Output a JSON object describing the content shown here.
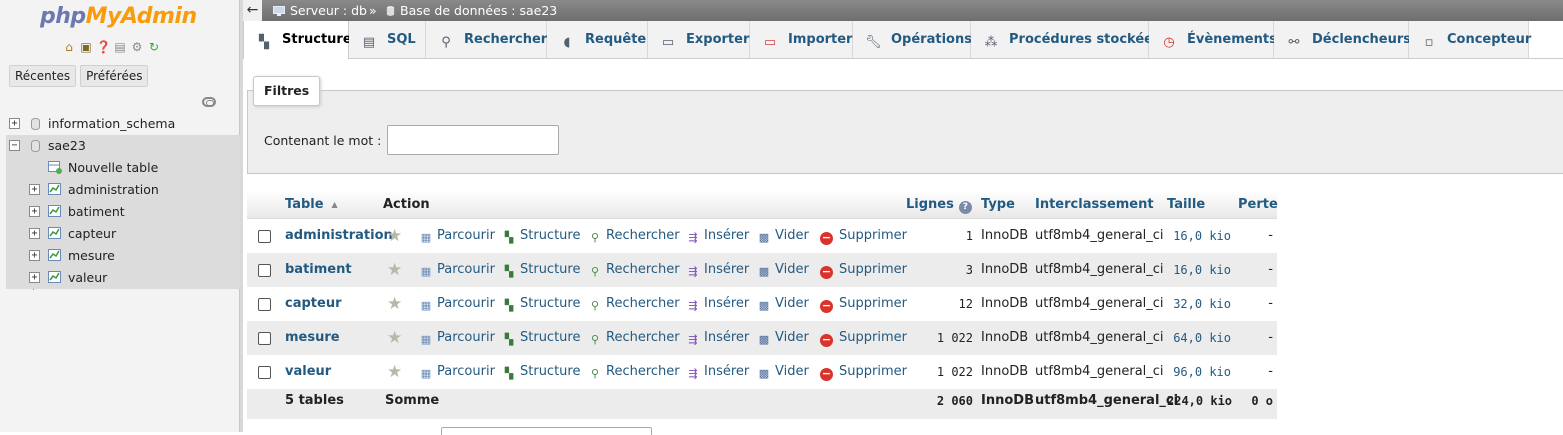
{
  "nav": {
    "logo_php": "php",
    "logo_myadmin": "MyAdmin",
    "icons": [
      "home-icon",
      "exit-icon",
      "help-icon",
      "docs-icon",
      "settings-icon",
      "reload-icon"
    ],
    "recent_label": "Récentes",
    "favorites_label": "Préférées",
    "tree": [
      {
        "label": "information_schema",
        "type": "database",
        "expander": "+"
      },
      {
        "label": "sae23",
        "type": "database",
        "expander": "−",
        "selected": true
      },
      {
        "label": "Nouvelle table",
        "type": "new-table"
      },
      {
        "label": "administration",
        "type": "table",
        "expander": "+"
      },
      {
        "label": "batiment",
        "type": "table",
        "expander": "+"
      },
      {
        "label": "capteur",
        "type": "table",
        "expander": "+"
      },
      {
        "label": "mesure",
        "type": "table",
        "expander": "+"
      },
      {
        "label": "valeur",
        "type": "table",
        "expander": "+"
      }
    ]
  },
  "breadcrumb": {
    "server": "Serveur : db",
    "separator": "»",
    "database": "Base de données : sae23"
  },
  "tabs": [
    {
      "label": "Structure",
      "icon": "structure-icon",
      "active": true
    },
    {
      "label": "SQL",
      "icon": "sql-icon"
    },
    {
      "label": "Rechercher",
      "icon": "search-icon"
    },
    {
      "label": "Requête",
      "icon": "query-icon"
    },
    {
      "label": "Exporter",
      "icon": "export-icon"
    },
    {
      "label": "Importer",
      "icon": "import-icon"
    },
    {
      "label": "Opérations",
      "icon": "wrench-icon"
    },
    {
      "label": "Procédures stockées",
      "icon": "routines-icon"
    },
    {
      "label": "Évènements",
      "icon": "clock-icon"
    },
    {
      "label": "Déclencheurs",
      "icon": "triggers-icon"
    },
    {
      "label": "Concepteur",
      "icon": "designer-icon"
    }
  ],
  "filters": {
    "legend": "Filtres",
    "contains_label": "Contenant le mot :",
    "contains_value": ""
  },
  "table": {
    "headers": {
      "table": "Table",
      "action": "Action",
      "rows": "Lignes",
      "type": "Type",
      "collation": "Interclassement",
      "size": "Taille",
      "overhead": "Perte"
    },
    "actions": {
      "browse": "Parcourir",
      "structure": "Structure",
      "search": "Rechercher",
      "insert": "Insérer",
      "empty": "Vider",
      "drop": "Supprimer"
    },
    "rows": [
      {
        "name": "administration",
        "rows": "1",
        "type": "InnoDB",
        "collation": "utf8mb4_general_ci",
        "size": "16,0 kio",
        "overhead": "-"
      },
      {
        "name": "batiment",
        "rows": "3",
        "type": "InnoDB",
        "collation": "utf8mb4_general_ci",
        "size": "16,0 kio",
        "overhead": "-"
      },
      {
        "name": "capteur",
        "rows": "12",
        "type": "InnoDB",
        "collation": "utf8mb4_general_ci",
        "size": "32,0 kio",
        "overhead": "-"
      },
      {
        "name": "mesure",
        "rows": "1 022",
        "type": "InnoDB",
        "collation": "utf8mb4_general_ci",
        "size": "64,0 kio",
        "overhead": "-"
      },
      {
        "name": "valeur",
        "rows": "1 022",
        "type": "InnoDB",
        "collation": "utf8mb4_general_ci",
        "size": "96,0 kio",
        "overhead": "-"
      }
    ],
    "footer": {
      "count": "5 tables",
      "sum_label": "Somme",
      "rows": "2 060",
      "type": "InnoDB",
      "collation": "utf8mb4_general_ci",
      "size": "224,0 kio",
      "overhead": "0 o"
    }
  }
}
